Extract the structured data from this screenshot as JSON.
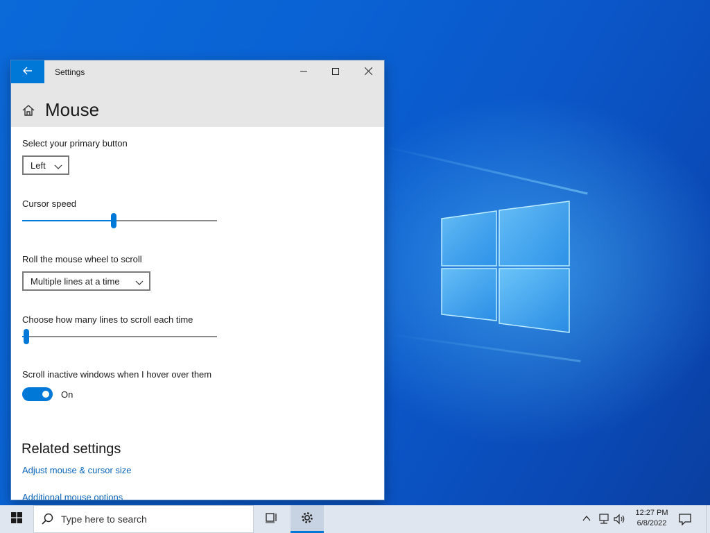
{
  "window": {
    "title": "Settings",
    "back_icon": "back-arrow-icon"
  },
  "page": {
    "title": "Mouse"
  },
  "primary_button": {
    "label": "Select your primary button",
    "value": "Left"
  },
  "cursor_speed": {
    "label": "Cursor speed",
    "level_fraction": 0.47
  },
  "wheel_scroll": {
    "label": "Roll the mouse wheel to scroll",
    "value": "Multiple lines at a time"
  },
  "lines_to_scroll": {
    "label": "Choose how many lines to scroll each time",
    "level_fraction": 0.02
  },
  "inactive_scroll": {
    "label": "Scroll inactive windows when I hover over them",
    "toggle_state": "On"
  },
  "related": {
    "heading": "Related settings",
    "links": [
      "Adjust mouse & cursor size",
      "Additional mouse options"
    ]
  },
  "taskbar": {
    "search_placeholder": "Type here to search",
    "time": "12:27 PM",
    "date": "6/8/2022"
  },
  "colors": {
    "accent": "#0078d7",
    "link": "#0a64b8",
    "desktop": "#0a5fcf"
  }
}
